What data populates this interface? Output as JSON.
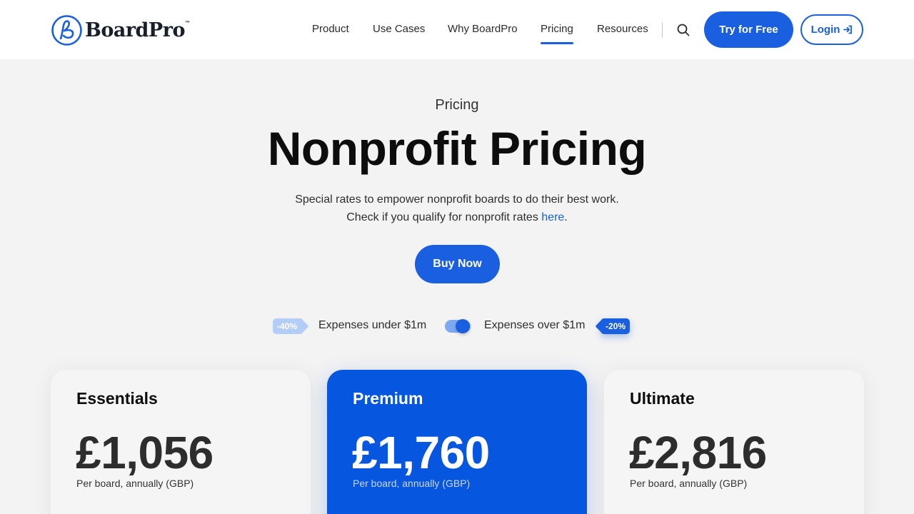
{
  "brand": {
    "name": "BoardPro",
    "trademark": "™",
    "color": "#1a5fe0"
  },
  "nav": {
    "items": [
      {
        "label": "Product"
      },
      {
        "label": "Use Cases"
      },
      {
        "label": "Why BoardPro"
      },
      {
        "label": "Pricing",
        "active": true
      },
      {
        "label": "Resources"
      }
    ],
    "search_icon": "search-icon",
    "cta_label": "Try for Free",
    "login_label": "Login",
    "login_icon": "login-arrow-icon"
  },
  "hero": {
    "eyebrow": "Pricing",
    "title": "Nonprofit Pricing",
    "subtitle_line1": "Special rates to empower nonprofit boards to do their best work.",
    "subtitle_line2_prefix": "Check if you qualify for nonprofit rates ",
    "subtitle_link": "here",
    "subtitle_line2_suffix": ".",
    "buy_label": "Buy Now"
  },
  "billing_toggle": {
    "left_badge": "-40%",
    "left_label": "Expenses under $1m",
    "right_label": "Expenses over $1m",
    "right_badge": "-20%",
    "selected": "Expenses over $1m"
  },
  "plans": [
    {
      "name": "Essentials",
      "price": "£1,056",
      "note": "Per board, annually (GBP)",
      "featured": false
    },
    {
      "name": "Premium",
      "price": "£1,760",
      "note": "Per board, annually (GBP)",
      "featured": true
    },
    {
      "name": "Ultimate",
      "price": "£2,816",
      "note": "Per board, annually (GBP)",
      "featured": false
    }
  ]
}
